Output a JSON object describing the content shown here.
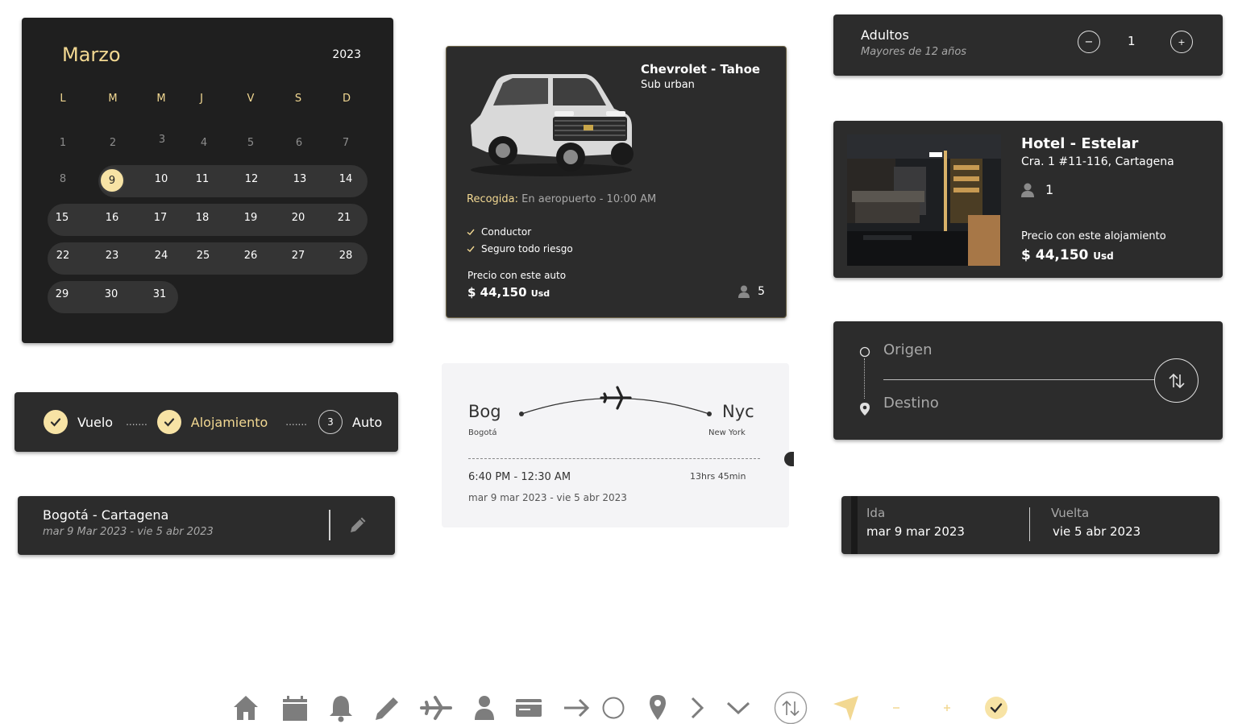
{
  "calendar": {
    "month": "Marzo",
    "year": "2023",
    "weekdays": [
      "L",
      "M",
      "M",
      "J",
      "V",
      "S",
      "D"
    ],
    "selected_day": "9",
    "days": {
      "d1": "1",
      "d2": "2",
      "d3": "3",
      "d4": "4",
      "d5": "5",
      "d6": "6",
      "d7": "7",
      "d8": "8",
      "d10": "10",
      "d11": "11",
      "d12": "12",
      "d13": "13",
      "d14": "14",
      "d15": "15",
      "d16": "16",
      "d17": "17",
      "d18": "18",
      "d19": "19",
      "d20": "20",
      "d21": "21",
      "d22": "22",
      "d23": "23",
      "d24": "24",
      "d25": "25",
      "d26": "26",
      "d27": "27",
      "d28": "28",
      "d29": "29",
      "d30": "30",
      "d31": "31"
    }
  },
  "stepper": {
    "steps": [
      {
        "label": "Vuelo",
        "state": "done"
      },
      {
        "label": "Alojamiento",
        "state": "done"
      },
      {
        "label": "Auto",
        "number": "3",
        "state": "current"
      }
    ]
  },
  "route": {
    "title": "Bogotá - Cartagena",
    "dates": "mar 9 Mar 2023  -    vie 5 abr 2023",
    "edit_icon": "pencil-icon"
  },
  "car": {
    "name": "Chevrolet - Tahoe",
    "subtitle": "Sub urban",
    "pickup_label": "Recogida:",
    "pickup_value": " En aeropuerto - 10:00 AM",
    "features": [
      "Conductor",
      "Seguro todo riesgo"
    ],
    "price_label": "Precio con este auto",
    "price": "$ 44,150",
    "currency": "Usd",
    "passengers": "5"
  },
  "flight": {
    "origin_code": "Bog",
    "origin_city": "Bogotá",
    "dest_code": "Nyc",
    "dest_city": "New York",
    "times": "6:40 PM - 12:30 AM",
    "duration": "13hrs 45min",
    "dates": "mar 9 mar 2023 - vie 5 abr 2023"
  },
  "adults": {
    "title": "Adultos",
    "subtitle": "Mayores de 12 años",
    "count": "1",
    "minus": "−",
    "plus": "+"
  },
  "hotel": {
    "name": "Hotel - Estelar",
    "address": "Cra. 1 #11-116, Cartagena",
    "guests": "1",
    "price_label": "Precio con este alojamiento",
    "price": "$ 44,150",
    "currency": "Usd"
  },
  "origin_destination": {
    "origin_placeholder": "Origen",
    "destination_placeholder": "Destino"
  },
  "dates": {
    "departure_label": "Ida",
    "departure_value": "mar 9 mar 2023",
    "return_label": "Vuelta",
    "return_value": "vie 5 abr 2023"
  },
  "icons": [
    "home-icon",
    "calendar-icon",
    "bell-icon",
    "pencil-icon",
    "plane-icon",
    "user-icon",
    "credit-card-icon",
    "arrow-right-icon",
    "circle-icon",
    "location-pin-icon",
    "chevron-right-icon",
    "chevron-down-icon",
    "swap-icon",
    "navigation-icon",
    "minus-icon",
    "plus-icon",
    "check-circle-icon"
  ],
  "colors": {
    "accent": "#f2d892",
    "accent_light": "#f7e3a5",
    "card_bg": "#2c2c2c",
    "calendar_bg": "#1f1f1f",
    "icon_gray": "#7d7d7d"
  }
}
